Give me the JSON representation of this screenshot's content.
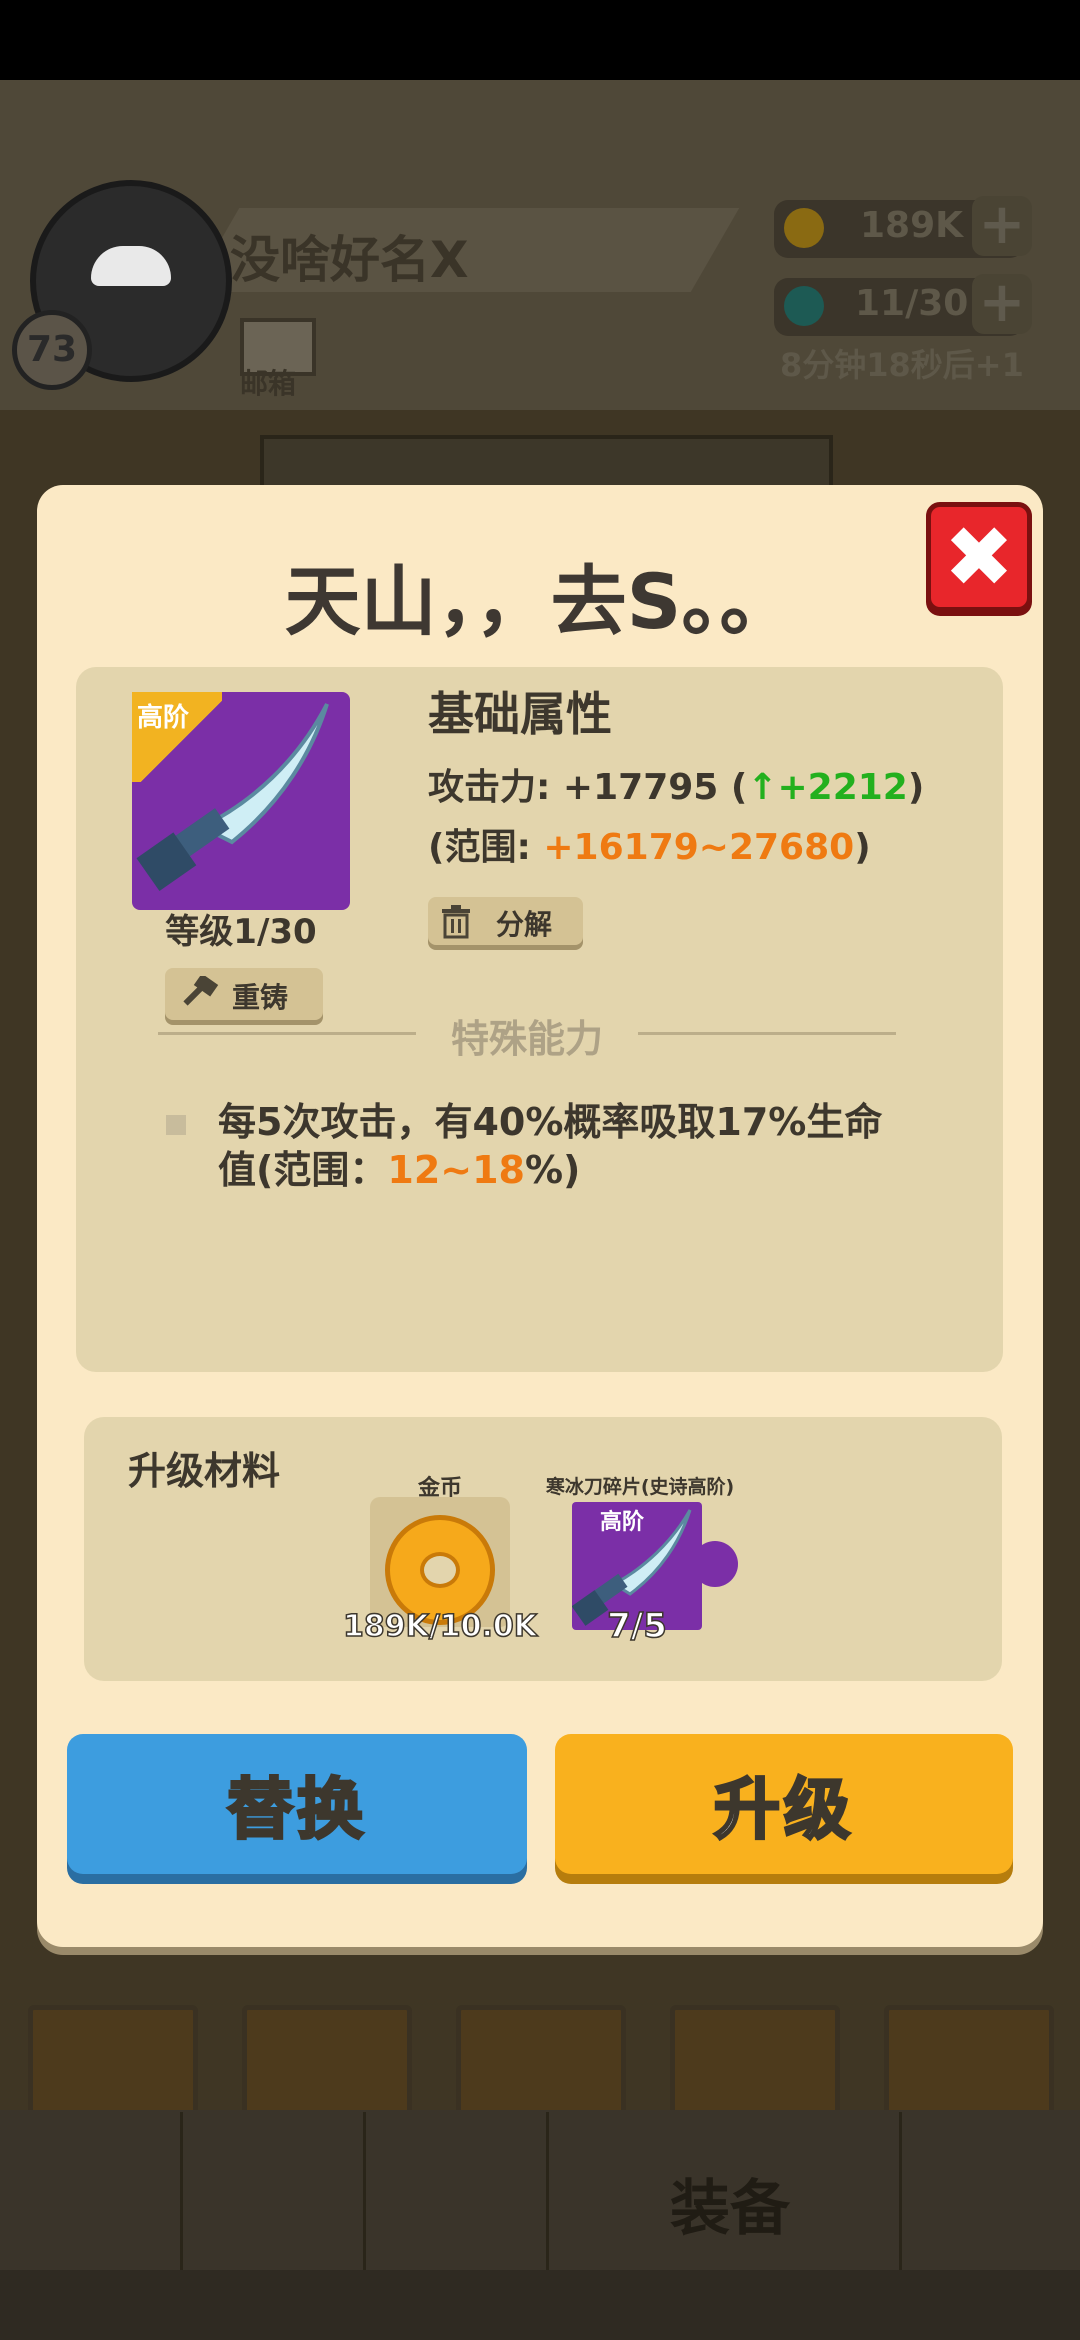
{
  "background": {
    "player": {
      "name": "没啥好名X",
      "level": "73"
    },
    "mail_label": "邮箱",
    "resources": {
      "gold": "189K",
      "gems": "11/30",
      "timer": "8分钟18秒后+1"
    },
    "nav": {
      "equip_label": "装备"
    }
  },
  "modal": {
    "title": "天山，，去S。。",
    "close_icon": "close-icon",
    "item": {
      "tier": "高阶",
      "level": "等级1/30",
      "reforge_label": "重铸",
      "decompose_label": "分解"
    },
    "basic": {
      "title": "基础属性",
      "atk_prefix": "攻击力: +17795 (",
      "atk_bonus": "↑+2212",
      "atk_suffix": ")",
      "range_prefix": "(范围: ",
      "range_value": "+16179~27680",
      "range_suffix": ")"
    },
    "special": {
      "title": "特殊能力",
      "text_main": "每5次攻击，有40%概率吸取17%生命值(范围：",
      "text_range": "12~18",
      "text_end": "%)"
    },
    "materials": {
      "title": "升级材料",
      "coin_label": "金币",
      "coin_count": "189K/10.0K",
      "shard_label": "寒冰刀碎片(史诗高阶)",
      "shard_tier": "高阶",
      "shard_count": "7/5"
    },
    "buttons": {
      "replace": "替换",
      "upgrade": "升级"
    }
  },
  "colors": {
    "modal_bg": "#fbe9c5",
    "card_bg": "#e3d5ad",
    "replace_btn": "#3d9ddf",
    "upgrade_btn": "#f9b11e",
    "close_btn": "#e8262b",
    "epic_purple": "#7b2fa7",
    "bonus_green": "#23b01e",
    "range_orange": "#ef7a12"
  }
}
